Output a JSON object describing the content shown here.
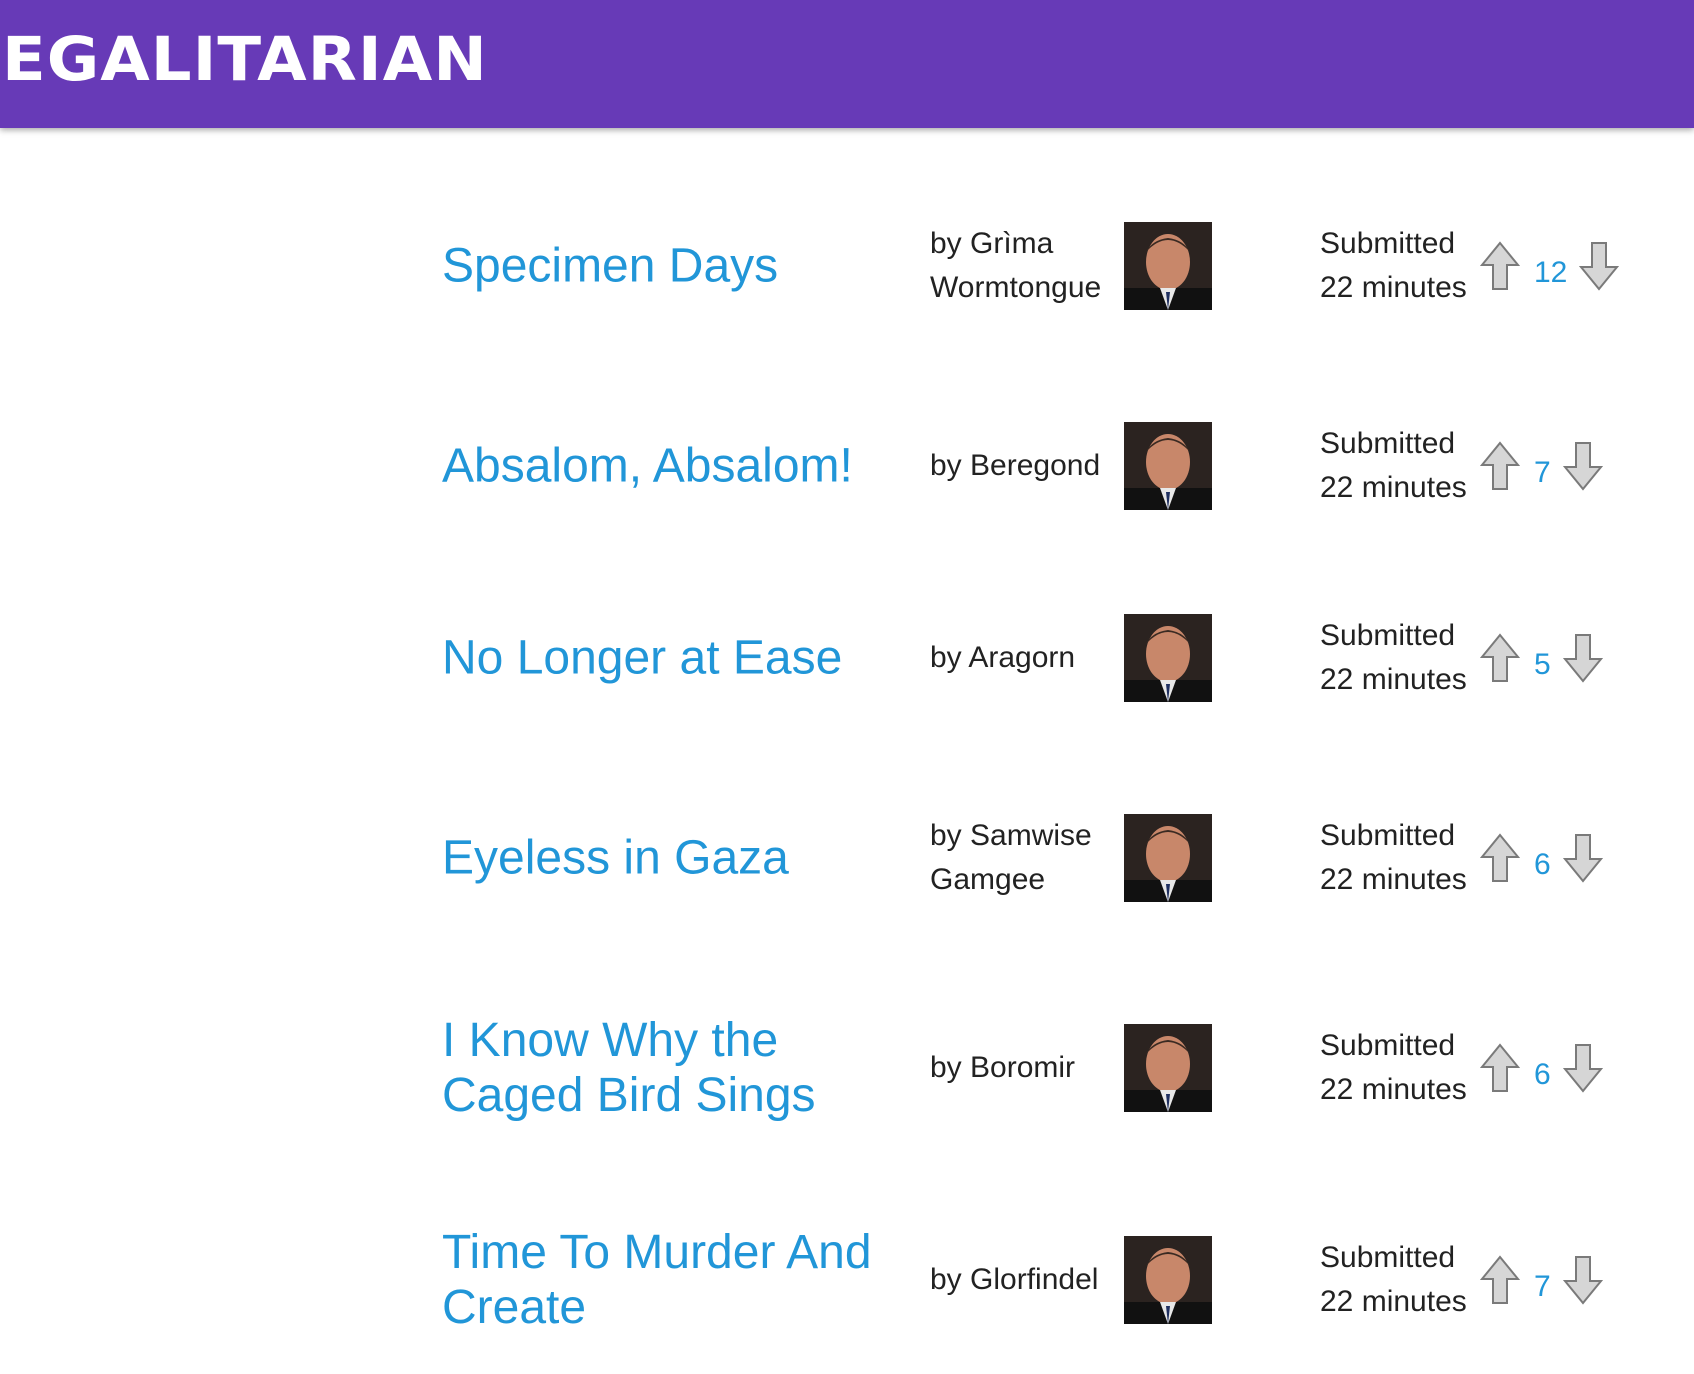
{
  "app": {
    "logo": "EGALITARIAN"
  },
  "posts": [
    {
      "title": "Specimen Days",
      "author": "by Grìma Wormtongue",
      "submitted": "Submitted 22 minutes",
      "votes": "12"
    },
    {
      "title": "Absalom, Absalom!",
      "author": "by Beregond",
      "submitted": "Submitted 22 minutes",
      "votes": "7"
    },
    {
      "title": "No Longer at Ease",
      "author": "by Aragorn",
      "submitted": "Submitted 22 minutes",
      "votes": "5"
    },
    {
      "title": "Eyeless in Gaza",
      "author": "by Samwise Gamgee",
      "submitted": "Submitted 22 minutes",
      "votes": "6"
    },
    {
      "title": "I Know Why the Caged Bird Sings",
      "author": "by Boromir",
      "submitted": "Submitted 22 minutes",
      "votes": "6"
    },
    {
      "title": "Time To Murder And Create",
      "author": "by Glorfindel",
      "submitted": "Submitted 22 minutes",
      "votes": "7"
    }
  ],
  "colors": {
    "header": "#673ab7",
    "link": "#2196d8"
  },
  "icons": {
    "upvote": "up-arrow-icon",
    "downvote": "down-arrow-icon",
    "avatar": "user-avatar"
  }
}
